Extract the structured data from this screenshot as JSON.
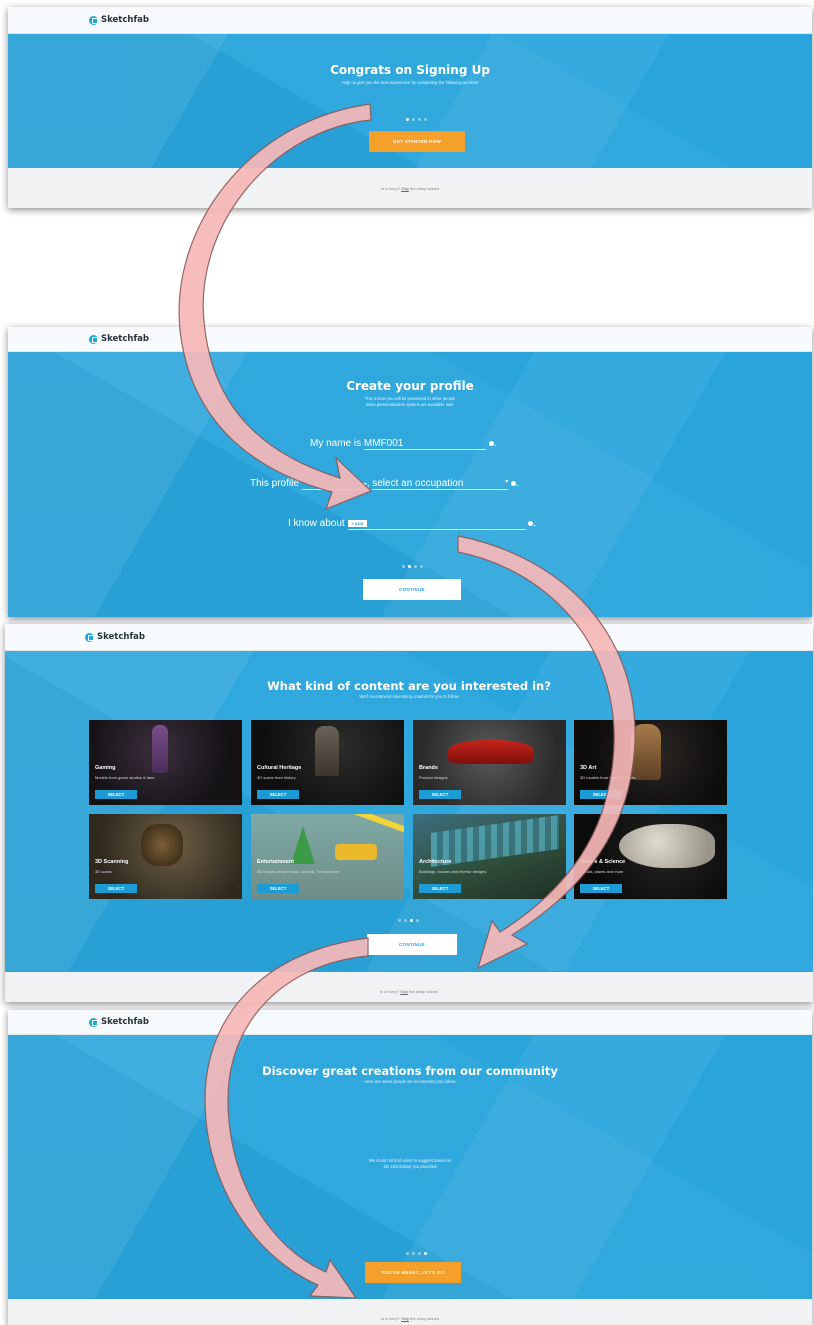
{
  "brand": "Sketchfab",
  "colors": {
    "sky": "#29a5dc",
    "cta": "#f5a02b",
    "arrow_fill": "#f7b8b8",
    "arrow_stroke": "#8c5a5a"
  },
  "step1": {
    "title": "Congrats on Signing Up",
    "subtitle": "Help us give you the best experience by completing the following sections",
    "cta": "GET STARTED NOW",
    "footer_pre": "In a hurry? ",
    "footer_link": "Skip",
    "footer_post": " the setup wizard"
  },
  "step2": {
    "title": "Create your profile",
    "subtitle_line1": "This is how you will be presented to other people",
    "subtitle_line2": "More personalization options are available later",
    "name_prefix": "My name is",
    "name_value": "MMF001",
    "profile_prefix": "This profile",
    "occupation_placeholder": "select an occupation",
    "know_prefix": "I know about",
    "add_tag": "+ ADD",
    "continue": "CONTINUE"
  },
  "step3": {
    "title": "What kind of content are you interested in?",
    "subtitle": "We'll recommend interesting creators for you to follow",
    "select_label": "SELECT",
    "cards": [
      {
        "title": "Gaming",
        "desc": "Models from game studios & fans"
      },
      {
        "title": "Cultural Heritage",
        "desc": "3D scans from history"
      },
      {
        "title": "Brands",
        "desc": "Product designs"
      },
      {
        "title": "3D Art",
        "desc": "3D models from talented artists"
      },
      {
        "title": "3D Scanning",
        "desc": "3D scans"
      },
      {
        "title": "Entertainment",
        "desc": "3D models about music, cinema, TV and more"
      },
      {
        "title": "Architecture",
        "desc": "Buildings, houses and interior designs"
      },
      {
        "title": "Nature & Science",
        "desc": "Fossils, plants and more"
      }
    ],
    "continue": "CONTINUE",
    "footer_pre": "In a hurry? ",
    "footer_link": "Skip",
    "footer_post": " the setup wizard"
  },
  "step4": {
    "title": "Discover great creations from our community",
    "subtitle": "Here are some people we recommend you follow",
    "empty_line1": "We could not find users to suggest based on",
    "empty_line2": "the information you provided",
    "cta": "YOU'RE READY, LET'S GO",
    "footer_pre": "In a hurry? ",
    "footer_link": "Skip",
    "footer_post": " the setup wizard"
  }
}
